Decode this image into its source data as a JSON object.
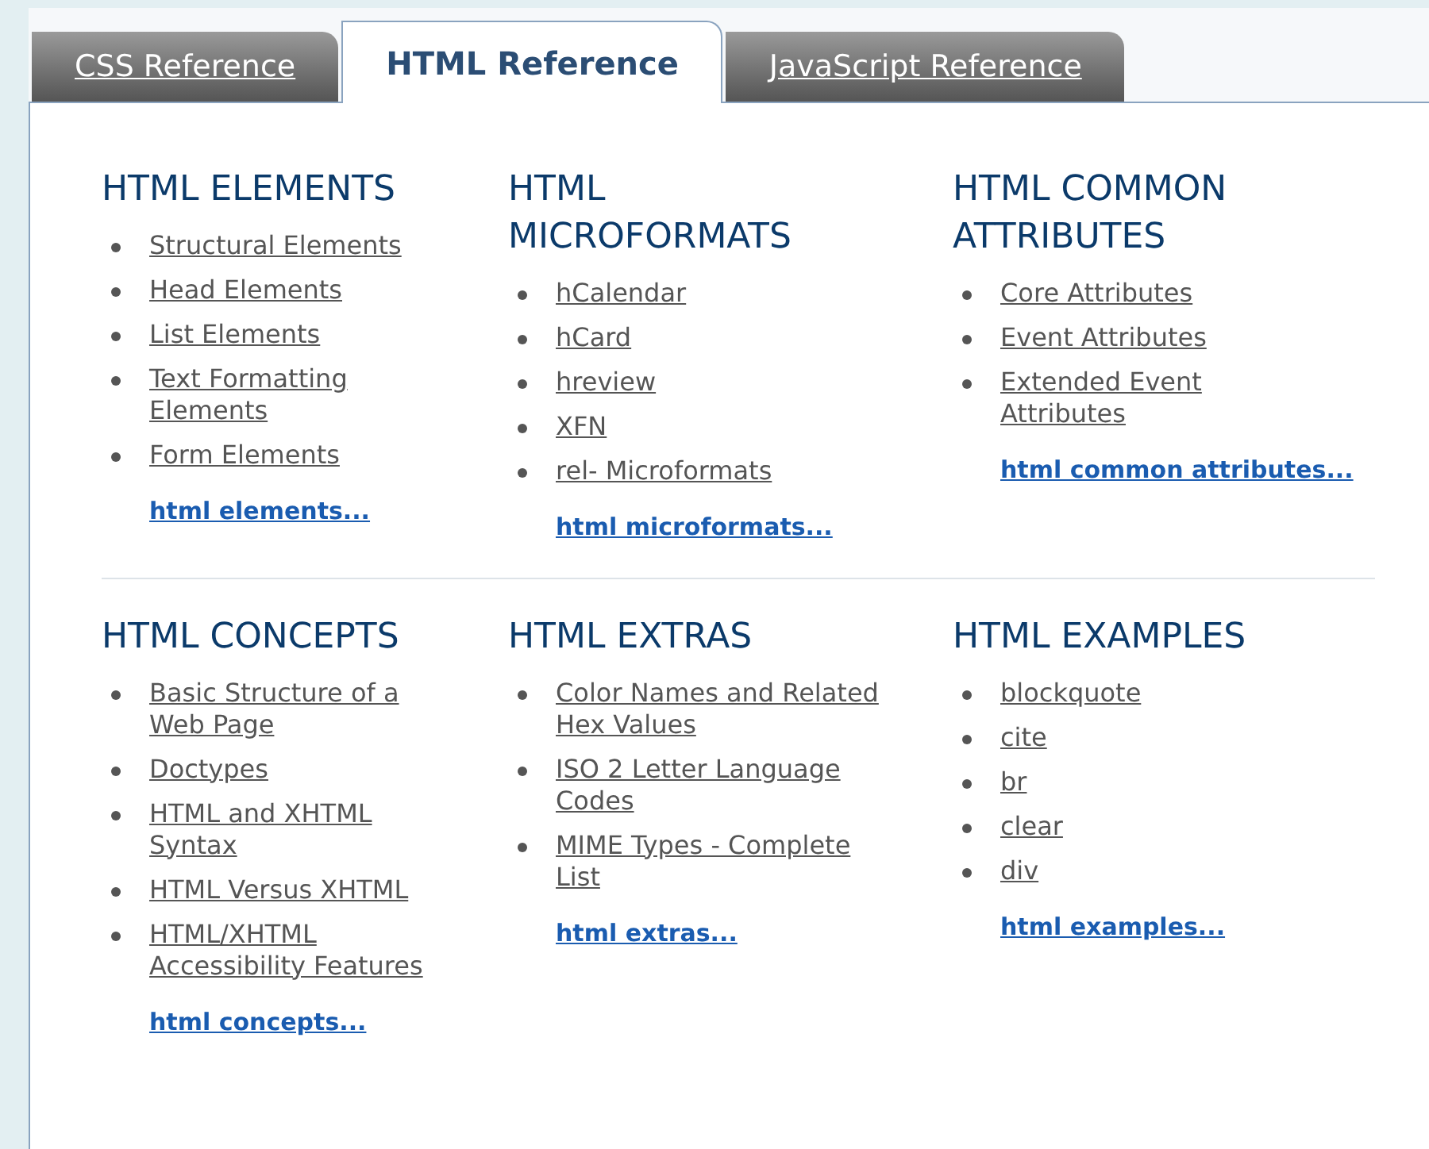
{
  "tabs": [
    {
      "label": "CSS Reference",
      "selected": false
    },
    {
      "label": "HTML Reference",
      "selected": true
    },
    {
      "label": "JavaScript Reference",
      "selected": false
    }
  ],
  "sections": [
    {
      "title": "HTML ELEMENTS",
      "items": [
        "Structural Elements",
        "Head Elements",
        "List Elements",
        "Text Formatting Elements",
        "Form Elements"
      ],
      "more": "html elements..."
    },
    {
      "title": "HTML MICROFORMATS",
      "items": [
        "hCalendar",
        "hCard",
        "hreview",
        "XFN",
        "rel- Microformats"
      ],
      "more": "html microformats..."
    },
    {
      "title": "HTML COMMON ATTRIBUTES",
      "items": [
        "Core Attributes",
        "Event Attributes",
        "Extended Event Attributes"
      ],
      "more": "html common attributes..."
    },
    {
      "title": "HTML CONCEPTS",
      "items": [
        "Basic Structure of a Web Page",
        "Doctypes",
        "HTML and XHTML Syntax",
        "HTML Versus XHTML",
        "HTML/XHTML Accessibility Features"
      ],
      "more": "html concepts..."
    },
    {
      "title": "HTML EXTRAS",
      "items": [
        "Color Names and Related Hex Values",
        "ISO 2 Letter Language Codes",
        "MIME Types - Complete List"
      ],
      "more": "html extras..."
    },
    {
      "title": "HTML EXAMPLES",
      "items": [
        "blockquote",
        "cite",
        "br",
        "clear",
        "div"
      ],
      "more": "html examples..."
    }
  ]
}
